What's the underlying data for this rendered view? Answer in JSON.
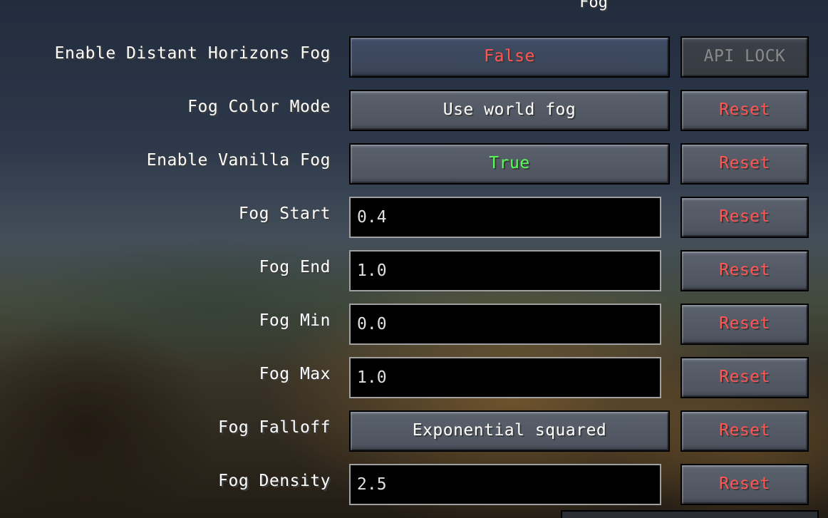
{
  "screen": {
    "title": "Fog"
  },
  "settings": [
    {
      "label": "Enable Distant Horizons Fog",
      "kind": "button",
      "value": "False",
      "value_color": "#ff5555",
      "reset": "API LOCK",
      "reset_disabled": true
    },
    {
      "label": "Fog Color Mode",
      "kind": "button",
      "value": "Use world fog",
      "reset": "Reset"
    },
    {
      "label": "Enable Vanilla Fog",
      "kind": "button",
      "value": "True",
      "value_color": "#55ff55",
      "reset": "Reset"
    },
    {
      "label": "Fog Start",
      "kind": "field",
      "value": "0.4",
      "reset": "Reset"
    },
    {
      "label": "Fog End",
      "kind": "field",
      "value": "1.0",
      "reset": "Reset"
    },
    {
      "label": "Fog Min",
      "kind": "field",
      "value": "0.0",
      "reset": "Reset"
    },
    {
      "label": "Fog Max",
      "kind": "field",
      "value": "1.0",
      "reset": "Reset"
    },
    {
      "label": "Fog Falloff",
      "kind": "button",
      "value": "Exponential squared",
      "reset": "Reset"
    },
    {
      "label": "Fog Density",
      "kind": "field",
      "value": "2.5",
      "reset": "Reset"
    }
  ],
  "colors": {
    "reset_text": "#ff5555",
    "false_text": "#ff5555",
    "true_text": "#55ff55",
    "disabled_text": "#8a8a8a"
  }
}
